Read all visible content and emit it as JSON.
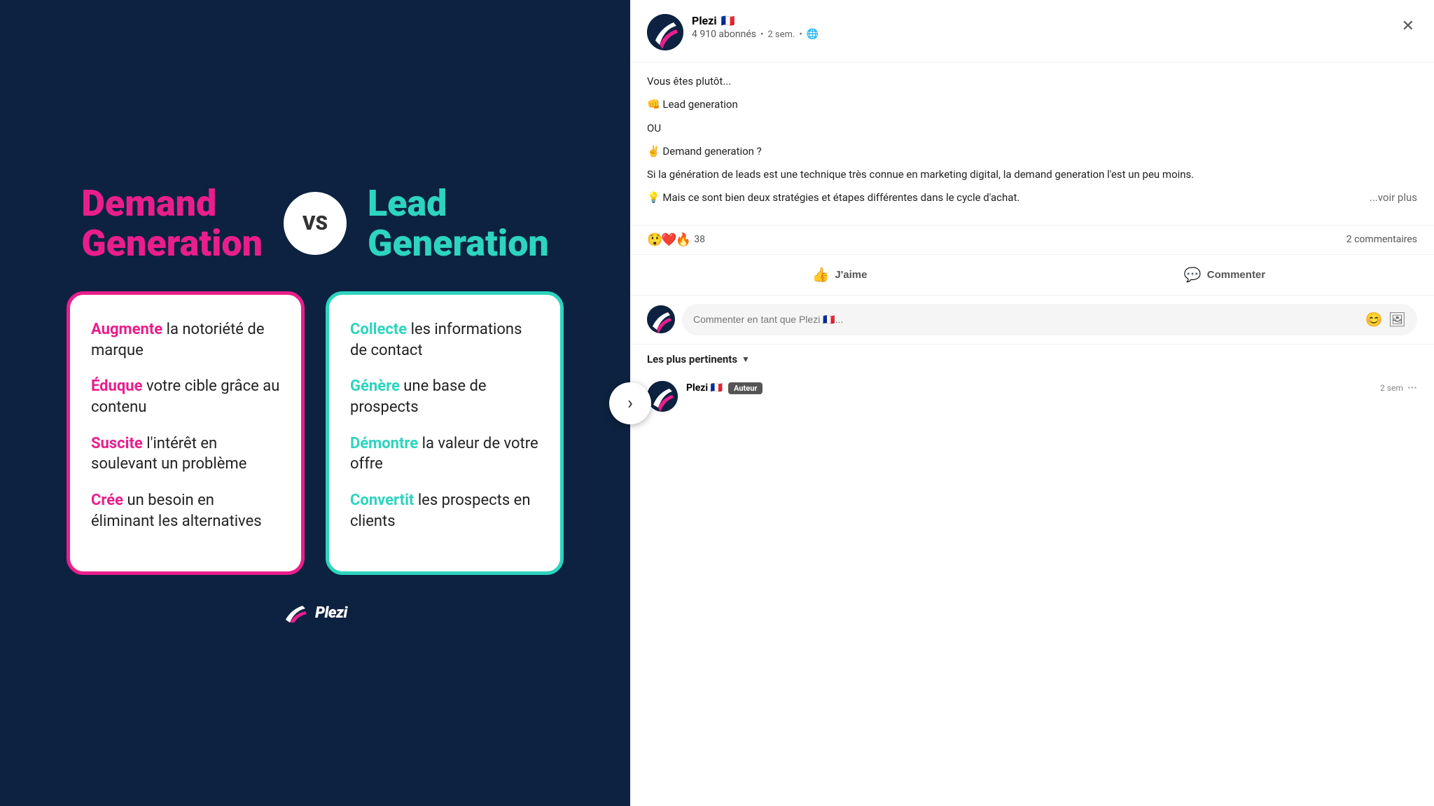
{
  "left": {
    "demand_title_line1": "Demand",
    "demand_title_line2": "Generation",
    "vs_label": "VS",
    "lead_title_line1": "Lead",
    "lead_title_line2": "Generation",
    "demand_items": [
      {
        "highlight": "Augmente",
        "rest": " la notoriété de marque"
      },
      {
        "highlight": "Éduque",
        "rest": " votre cible grâce au contenu"
      },
      {
        "highlight": "Suscite",
        "rest": " l'intérêt en soulevant un problème"
      },
      {
        "highlight": "Crée",
        "rest": " un besoin en éliminant les alternatives"
      }
    ],
    "lead_items": [
      {
        "highlight": "Collecte",
        "rest": " les informations de contact"
      },
      {
        "highlight": "Génère",
        "rest": " une base de prospects"
      },
      {
        "highlight": "Démontre",
        "rest": " la valeur de votre offre"
      },
      {
        "highlight": "Convertit",
        "rest": " les prospects en clients"
      }
    ],
    "plezi_logo": "✦Plezi"
  },
  "right": {
    "author_name": "Plezi",
    "author_flag": "🇫🇷",
    "subscribers": "4 910 abonnés",
    "time_ago": "2 sem.",
    "globe_icon": "🌐",
    "post_lines": [
      "Vous êtes plutôt...",
      "",
      "👊 Lead generation",
      "",
      "OU",
      "",
      "✌️ Demand generation ?",
      "",
      "Si la génération de leads est une technique très connue en marketing digital, la demand generation l'est un peu moins.",
      "",
      "💡 Mais ce sont bien deux stratégies et étapes différentes dans le cycle d'achat."
    ],
    "see_more": "...voir plus",
    "reactions_count": "38",
    "comments_count": "2 commentaires",
    "like_label": "J'aime",
    "comment_label": "Commenter",
    "comment_placeholder": "Commenter en tant que Plezi 🇫🇷...",
    "sort_label": "Les plus pertinents",
    "nav_arrow": "›",
    "comment": {
      "author": "Plezi",
      "flag": "🇫🇷",
      "badge": "Auteur",
      "time": "2 sem",
      "dots": "···"
    }
  },
  "icons": {
    "close": "✕",
    "like_icon": "👍",
    "comment_icon": "💬",
    "emoji_icon": "😊",
    "image_icon": "🖼",
    "reactions": [
      "😲",
      "❤️",
      "🔥"
    ]
  }
}
